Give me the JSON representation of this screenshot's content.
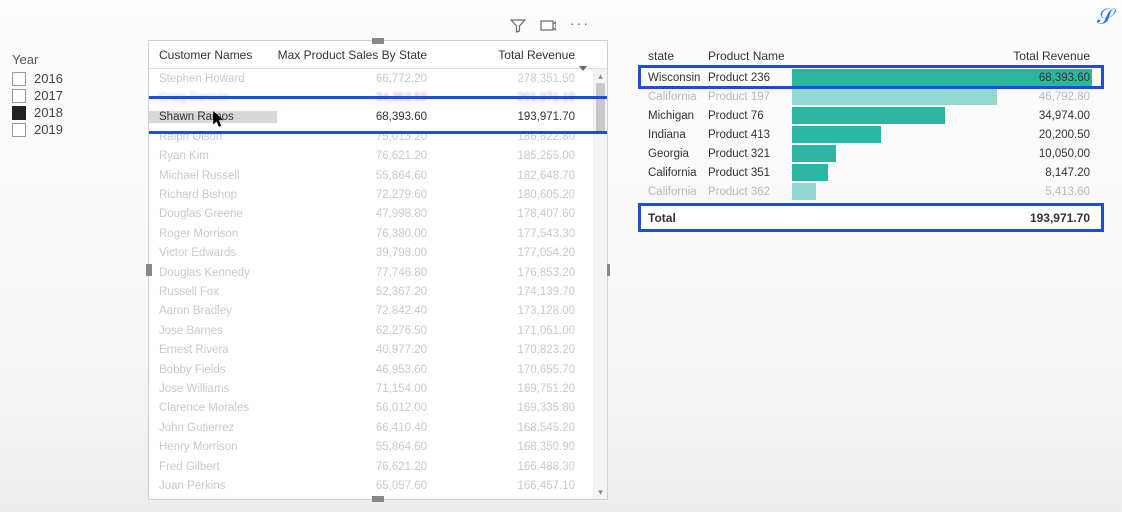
{
  "slicer": {
    "title": "Year",
    "items": [
      {
        "label": "2016",
        "checked": false
      },
      {
        "label": "2017",
        "checked": false
      },
      {
        "label": "2018",
        "checked": true
      },
      {
        "label": "2019",
        "checked": false
      }
    ]
  },
  "leftTable": {
    "headers": {
      "c1": "Customer Names",
      "c2": "Max Product Sales By State",
      "c3": "Total Revenue"
    },
    "selectedIndex": 2,
    "rows": [
      {
        "name": "Stephen Howard",
        "max": "66,772.20",
        "rev": "278,351.50"
      },
      {
        "name": "Craig Daniels",
        "max": "34,353.50",
        "rev": "201,971.10",
        "blur": true
      },
      {
        "name": "Shawn Ramos",
        "max": "68,393.60",
        "rev": "193,971.70"
      },
      {
        "name": "Ralph Olson",
        "max": "75,013.20",
        "rev": "186,822.80"
      },
      {
        "name": "Ryan Kim",
        "max": "76,621.20",
        "rev": "185,255.00"
      },
      {
        "name": "Michael Russell",
        "max": "55,864.60",
        "rev": "182,648.70"
      },
      {
        "name": "Richard Bishop",
        "max": "72,279.60",
        "rev": "180,605.20"
      },
      {
        "name": "Douglas Greene",
        "max": "47,998.80",
        "rev": "178,407.60"
      },
      {
        "name": "Roger Morrison",
        "max": "76,380.00",
        "rev": "177,543.30"
      },
      {
        "name": "Victor Edwards",
        "max": "39,798.00",
        "rev": "177,054.20"
      },
      {
        "name": "Douglas Kennedy",
        "max": "77,746.80",
        "rev": "176,853.20"
      },
      {
        "name": "Russell Fox",
        "max": "52,367.20",
        "rev": "174,139.70"
      },
      {
        "name": "Aaron Bradley",
        "max": "72,842.40",
        "rev": "173,128.00"
      },
      {
        "name": "Jose Barnes",
        "max": "62,276.50",
        "rev": "171,051.00"
      },
      {
        "name": "Ernest Rivera",
        "max": "40,977.20",
        "rev": "170,823.20"
      },
      {
        "name": "Bobby Fields",
        "max": "46,953.60",
        "rev": "170,655.70"
      },
      {
        "name": "Jose Williams",
        "max": "71,154.00",
        "rev": "169,751.20"
      },
      {
        "name": "Clarence Morales",
        "max": "56,012.00",
        "rev": "169,335.80"
      },
      {
        "name": "John Gutierrez",
        "max": "66,410.40",
        "rev": "168,545.20"
      },
      {
        "name": "Henry Morrison",
        "max": "55,864.60",
        "rev": "168,350.90"
      },
      {
        "name": "Fred Gilbert",
        "max": "76,621.20",
        "rev": "166,488.30"
      },
      {
        "name": "Juan Perkins",
        "max": "65,057.60",
        "rev": "166,457.10"
      }
    ]
  },
  "rightTable": {
    "headers": {
      "c1": "state",
      "c2": "Product Name",
      "c3": "Total Revenue"
    },
    "maxBar": 68393.6,
    "rows": [
      {
        "state": "Wisconsin",
        "product": "Product 236",
        "rev": "68,393.60",
        "val": 68393.6
      },
      {
        "state": "California",
        "product": "Product 197",
        "rev": "46,792.80",
        "val": 46792.8,
        "faded": true
      },
      {
        "state": "Michigan",
        "product": "Product 76",
        "rev": "34,974.00",
        "val": 34974.0
      },
      {
        "state": "Indiana",
        "product": "Product 413",
        "rev": "20,200.50",
        "val": 20200.5
      },
      {
        "state": "Georgia",
        "product": "Product 321",
        "rev": "10,050.00",
        "val": 10050.0
      },
      {
        "state": "California",
        "product": "Product 351",
        "rev": "8,147.20",
        "val": 8147.2
      },
      {
        "state": "California",
        "product": "Product 362",
        "rev": "5,413.60",
        "val": 5413.6,
        "faded": true
      }
    ],
    "total": {
      "label": "Total",
      "rev": "193,971.70"
    }
  },
  "iconNames": {
    "filter": "filter-icon",
    "focus": "focus-mode-icon",
    "more": "more-options-icon"
  }
}
